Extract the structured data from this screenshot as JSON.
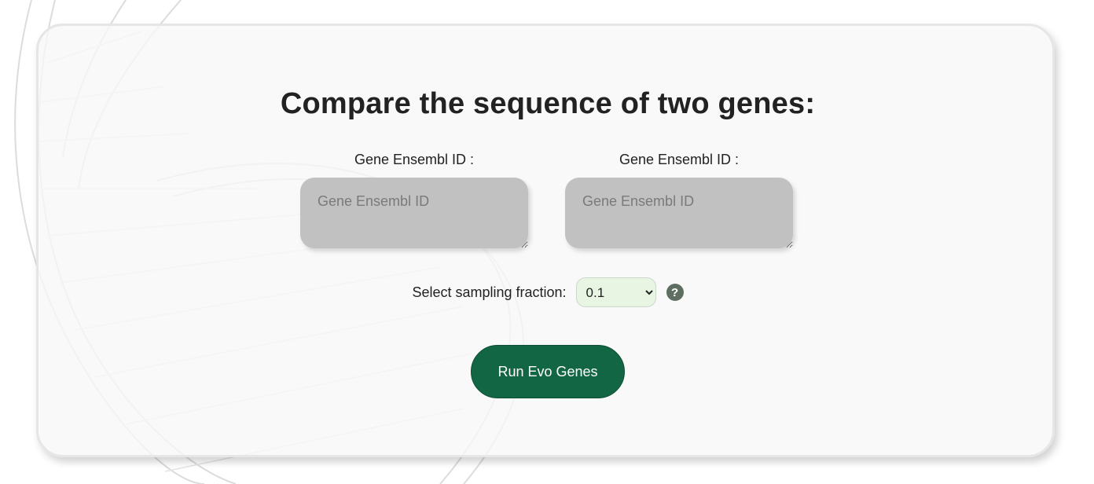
{
  "form": {
    "title": "Compare the sequence of two genes:",
    "gene1": {
      "label": "Gene Ensembl ID :",
      "placeholder": "Gene Ensembl ID",
      "value": ""
    },
    "gene2": {
      "label": "Gene Ensembl ID :",
      "placeholder": "Gene Ensembl ID",
      "value": ""
    },
    "sampling": {
      "label": "Select sampling fraction:",
      "selected": "0.1",
      "help_icon": "question-mark-icon"
    },
    "submit_label": "Run Evo Genes"
  },
  "colors": {
    "button": "#136644",
    "input_bg": "#c1c1c1",
    "select_bg": "#e8f5e3",
    "help_icon_bg": "#5e6f62",
    "card_bg": "#f7f7f7"
  }
}
